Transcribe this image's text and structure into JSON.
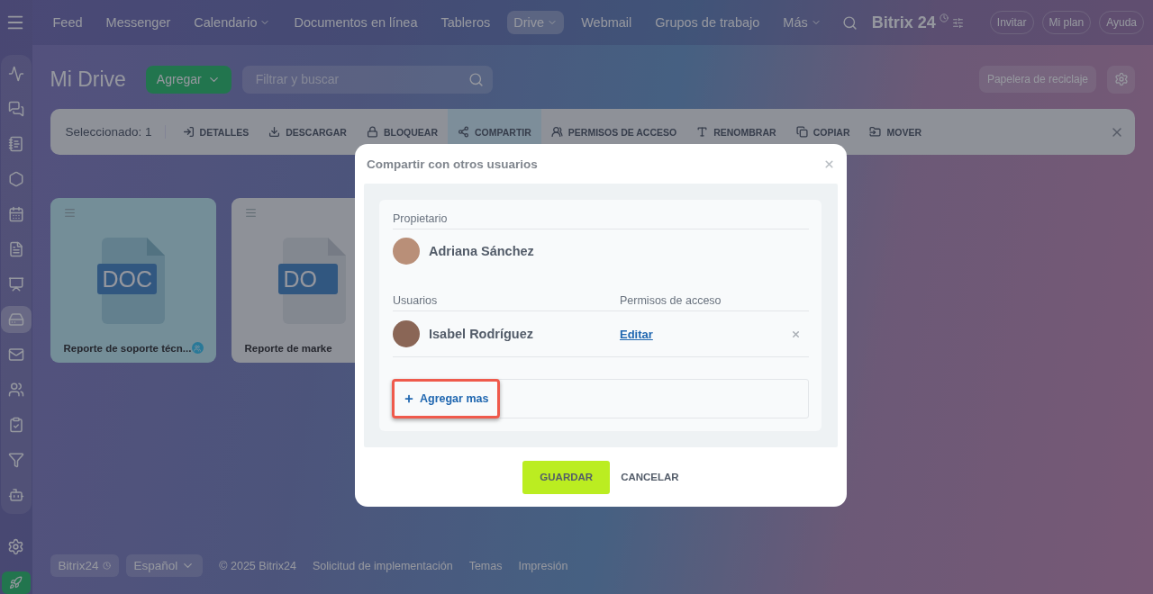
{
  "sidebar": {
    "items": [
      {
        "selected": false
      },
      {
        "selected": false
      },
      {
        "selected": false
      },
      {
        "selected": false
      },
      {
        "selected": false
      },
      {
        "selected": false
      },
      {
        "selected": false
      },
      {
        "selected": true
      },
      {
        "selected": false
      },
      {
        "selected": false
      },
      {
        "selected": false
      },
      {
        "selected": false
      },
      {
        "selected": false
      }
    ]
  },
  "nav": {
    "items": [
      {
        "label": "Feed",
        "selected": false,
        "dropdown": false
      },
      {
        "label": "Messenger",
        "selected": false,
        "dropdown": false
      },
      {
        "label": "Calendario",
        "selected": false,
        "dropdown": true
      },
      {
        "label": "Documentos en línea",
        "selected": false,
        "dropdown": false
      },
      {
        "label": "Tableros",
        "selected": false,
        "dropdown": false
      },
      {
        "label": "Drive",
        "selected": true,
        "dropdown": true
      },
      {
        "label": "Webmail",
        "selected": false,
        "dropdown": false
      },
      {
        "label": "Grupos de trabajo",
        "selected": false,
        "dropdown": false
      },
      {
        "label": "Más",
        "selected": false,
        "dropdown": true
      }
    ],
    "logo": "Bitrix 24",
    "buttons": [
      "Invitar",
      "Mi plan",
      "Ayuda"
    ]
  },
  "page": {
    "title": "Mi Drive",
    "add_button": "Agregar",
    "search": {
      "placeholder": "Filtrar y buscar"
    },
    "recycle_button": "Papelera de reciclaje"
  },
  "toolbar": {
    "selected_count": "Seleccionado: 1",
    "actions": [
      {
        "label": "DETALLES",
        "selected": false
      },
      {
        "label": "DESCARGAR",
        "selected": false
      },
      {
        "label": "BLOQUEAR",
        "selected": false
      },
      {
        "label": "COMPARTIR",
        "selected": true
      },
      {
        "label": "PERMISOS DE ACCESO",
        "selected": false
      },
      {
        "label": "RENOMBRAR",
        "selected": false
      },
      {
        "label": "COPIAR",
        "selected": false
      },
      {
        "label": "MOVER",
        "selected": false
      }
    ]
  },
  "files": [
    {
      "name": "Reporte de soporte técn...",
      "type": "DOC",
      "selected": true,
      "shared": true
    },
    {
      "name": "Reporte de marke",
      "type": "DO",
      "selected": false,
      "shared": false
    }
  ],
  "footer": {
    "brand": "Bitrix24",
    "language": "Español",
    "copyright": "© 2025 Bitrix24",
    "links": [
      "Solicitud de implementación",
      "Temas",
      "Impresión"
    ]
  },
  "dialog": {
    "title": "Compartir con otros usuarios",
    "owner_label": "Propietario",
    "owner": "Adriana Sánchez",
    "users_label": "Usuarios",
    "permissions_label": "Permisos de acceso",
    "users": [
      {
        "name": "Isabel Rodríguez",
        "permission": "Editar"
      }
    ],
    "add_more": "Agregar mas",
    "add_more_highlighted": true,
    "save": "GUARDAR",
    "cancel": "CANCELAR"
  }
}
